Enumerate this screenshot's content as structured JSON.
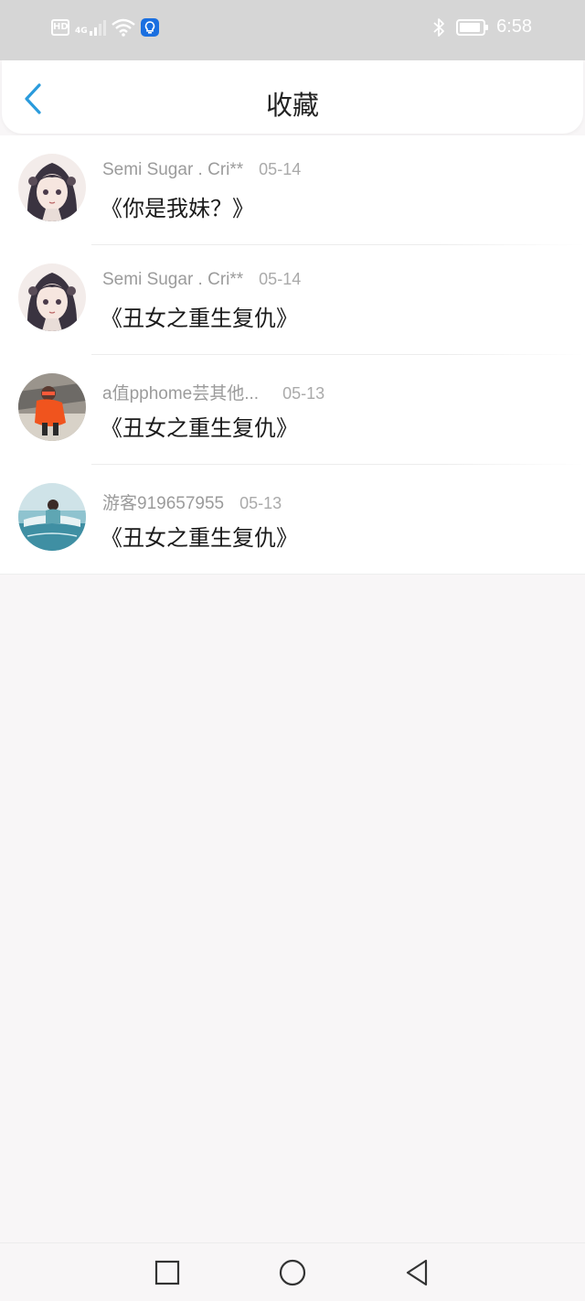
{
  "status_bar": {
    "time": "6:58",
    "hd_label": "HD",
    "network_label": "4G",
    "battery_level": 0.9,
    "icons": [
      "hd-icon",
      "signal-icon",
      "wifi-icon",
      "app-notification-icon",
      "bluetooth-icon",
      "battery-icon"
    ]
  },
  "header": {
    "title": "收藏",
    "back_icon": "chevron-left-icon"
  },
  "favorites": [
    {
      "user": "Semi Sugar . Cri**",
      "date": "05-14",
      "title": "《你是我妹？》",
      "avatar": "anime-girl"
    },
    {
      "user": "Semi Sugar . Cri**",
      "date": "05-14",
      "title": "《丑女之重生复仇》",
      "avatar": "anime-girl"
    },
    {
      "user": "a值pphome芸其他...",
      "date": "05-13",
      "title": "《丑女之重生复仇》",
      "avatar": "orange-photo"
    },
    {
      "user": "游客919657955",
      "date": "05-13",
      "title": "《丑女之重生复仇》",
      "avatar": "pool-photo"
    }
  ],
  "system_nav": {
    "icons": [
      "recents-square-icon",
      "home-circle-icon",
      "back-triangle-icon"
    ]
  },
  "colors": {
    "accent": "#2a9bdc",
    "background": "#f8f6f7",
    "statusbar": "#d6d6d6"
  }
}
